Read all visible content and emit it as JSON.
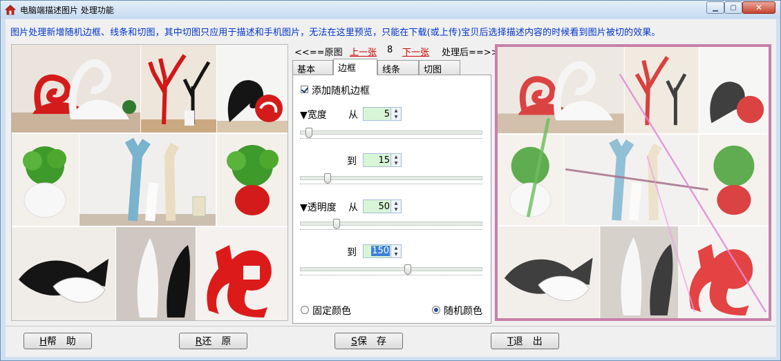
{
  "window": {
    "title": "电脑端描述图片 处理功能",
    "controls": {
      "minimize": "▁",
      "maximize": "▢",
      "close": "✕"
    }
  },
  "notice": "图片处理新增随机边框、线条和切图，其中切图只应用于描述和手机图片，无法在这里预览，只能在下载(或上传)宝贝后选择描述内容的时候看到图片被切的效果。",
  "nav": {
    "original": "<<==原图",
    "prev": "上一张",
    "index": "8",
    "next": "下一张",
    "processed": "处理后==>>"
  },
  "tabs": [
    {
      "label": "基本",
      "active": false
    },
    {
      "label": "边框",
      "active": true
    },
    {
      "label": "线条",
      "active": false
    },
    {
      "label": "切图",
      "active": false
    }
  ],
  "border_tab": {
    "add_random_border": {
      "label": "添加随机边框",
      "checked": true
    },
    "width_label": "▼宽度",
    "from_label": "从",
    "to_label": "到",
    "opacity_label": "▼透明度",
    "width_from": {
      "value": "5",
      "slider_fraction": 0.05
    },
    "width_to": {
      "value": "15",
      "slider_fraction": 0.15
    },
    "opacity_from": {
      "value": "50",
      "slider_fraction": 0.2
    },
    "opacity_to": {
      "value": "150",
      "slider_fraction": 0.59
    },
    "fixed_color": {
      "label": "固定颜色",
      "selected": false
    },
    "random_color": {
      "label": "随机颜色",
      "selected": true
    }
  },
  "buttons": {
    "help": {
      "key": "H",
      "label": "帮　助"
    },
    "restore": {
      "key": "R",
      "label": "还　原"
    },
    "save": {
      "key": "S",
      "label": "保　存"
    },
    "exit": {
      "key": "T",
      "label": "退　出"
    }
  },
  "colors": {
    "title_blue": "#0033cc",
    "link_red": "#d00000",
    "border_accent": "#c87fa9",
    "spin_bg": "#d9f5d8"
  }
}
